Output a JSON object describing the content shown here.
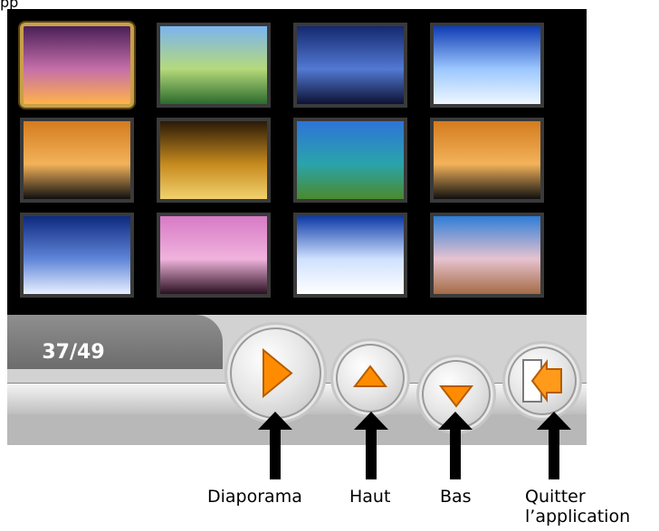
{
  "header": {
    "text": "pp"
  },
  "gallery": {
    "selected_index": 0,
    "thumbnails": [
      {
        "name": "thumb-sunset-tree",
        "colors": [
          "#4a1f57",
          "#c56fa9",
          "#ffb24a"
        ]
      },
      {
        "name": "thumb-valley",
        "colors": [
          "#7bb4f0",
          "#b5d97b",
          "#2b6b2d"
        ]
      },
      {
        "name": "thumb-lightning",
        "colors": [
          "#14286d",
          "#5279d4",
          "#0c1233"
        ]
      },
      {
        "name": "thumb-ice-arch",
        "colors": [
          "#0f3cb3",
          "#9cc7ff",
          "#eef7ff"
        ]
      },
      {
        "name": "thumb-lake-sunset-1",
        "colors": [
          "#d47b1e",
          "#f3b25a",
          "#101010"
        ]
      },
      {
        "name": "thumb-louvre",
        "colors": [
          "#2a1a08",
          "#c68a1e",
          "#f1d16d"
        ]
      },
      {
        "name": "thumb-tropical-coast",
        "colors": [
          "#2e73d8",
          "#2aa4ab",
          "#4a8a2c"
        ]
      },
      {
        "name": "thumb-lake-sunset-2",
        "colors": [
          "#d47b1e",
          "#f3b25a",
          "#101010"
        ]
      },
      {
        "name": "thumb-ice-water",
        "colors": [
          "#0d2a7e",
          "#5f85d8",
          "#e8f0ff"
        ]
      },
      {
        "name": "thumb-palm-sunset",
        "colors": [
          "#d77ac6",
          "#f0b3dd",
          "#2a1020"
        ]
      },
      {
        "name": "thumb-snow-trees",
        "colors": [
          "#0d3aa6",
          "#cfe1ff",
          "#ffffff"
        ]
      },
      {
        "name": "thumb-blossom",
        "colors": [
          "#2f7dd7",
          "#e7c3cf",
          "#a46b45"
        ]
      }
    ]
  },
  "status": {
    "counter": "37/49"
  },
  "controls": {
    "accent": "#ff8c00",
    "labels": {
      "slideshow": "Diaporama",
      "up": "Haut",
      "down": "Bas",
      "quit_line1": "Quitter",
      "quit_line2": "l’application"
    }
  }
}
